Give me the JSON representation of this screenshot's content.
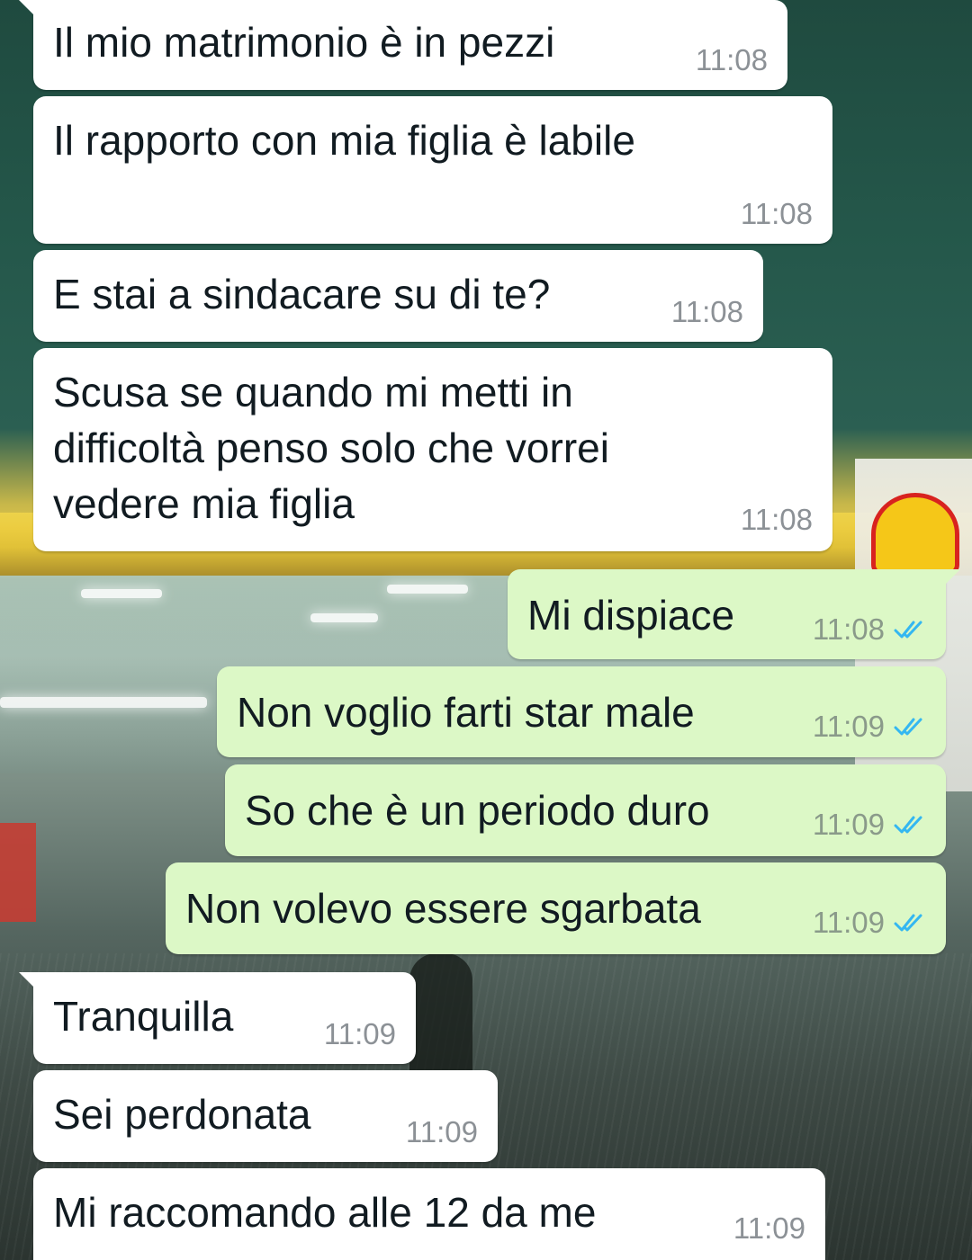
{
  "colors": {
    "incoming_bubble": "#ffffff",
    "outgoing_bubble": "#dcf8c6",
    "text": "#111b21",
    "time": "#8c9196",
    "read_ticks": "#34b7f1"
  },
  "messages": [
    {
      "direction": "in",
      "text": "Il mio matrimonio è in pezzi",
      "time": "11:08"
    },
    {
      "direction": "in",
      "text": "Il rapporto con mia figlia è labile",
      "time": "11:08"
    },
    {
      "direction": "in",
      "text": "E stai a sindacare su di te?",
      "time": "11:08"
    },
    {
      "direction": "in",
      "text_lines": [
        "Scusa se quando mi metti in",
        "difficoltà penso solo che vorrei",
        "vedere mia figlia"
      ],
      "time": "11:08"
    },
    {
      "direction": "out",
      "text": "Mi dispiace",
      "time": "11:08",
      "status": "read"
    },
    {
      "direction": "out",
      "text": "Non voglio farti star male",
      "time": "11:09",
      "status": "read"
    },
    {
      "direction": "out",
      "text": "So che è un periodo duro",
      "time": "11:09",
      "status": "read"
    },
    {
      "direction": "out",
      "text": "Non volevo essere sgarbata",
      "time": "11:09",
      "status": "read"
    },
    {
      "direction": "in",
      "text": "Tranquilla",
      "time": "11:09"
    },
    {
      "direction": "in",
      "text": "Sei perdonata",
      "time": "11:09"
    },
    {
      "direction": "in",
      "text": "Mi raccomando alle 12 da me",
      "time": "11:09"
    }
  ],
  "icons": {
    "read_status": "double-check-icon"
  }
}
